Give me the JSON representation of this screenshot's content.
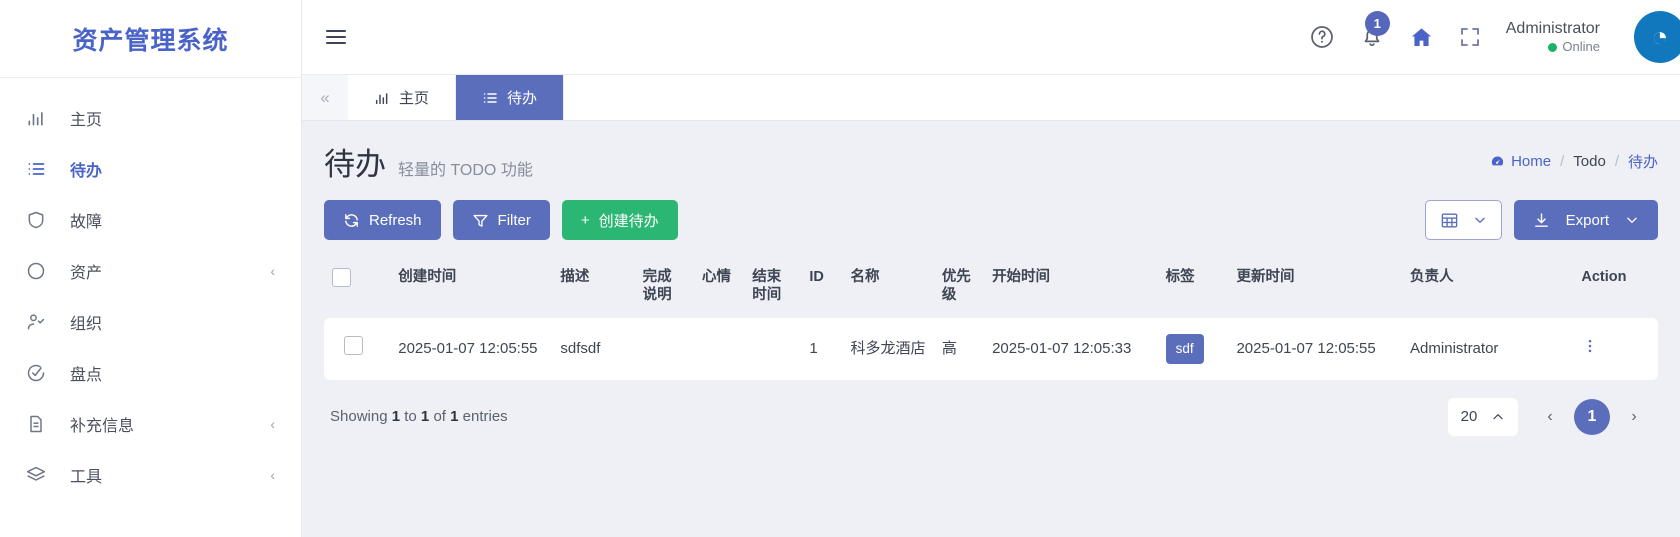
{
  "sidebar": {
    "brand": "资产管理系统",
    "items": [
      {
        "label": "主页",
        "icon": "bar-chart-icon",
        "active": false,
        "caret": ""
      },
      {
        "label": "待办",
        "icon": "list-icon",
        "active": true,
        "caret": ""
      },
      {
        "label": "故障",
        "icon": "shield-icon",
        "active": false,
        "caret": ""
      },
      {
        "label": "资产",
        "icon": "circle-icon",
        "active": false,
        "caret": "‹"
      },
      {
        "label": "组织",
        "icon": "user-check-icon",
        "active": false,
        "caret": ""
      },
      {
        "label": "盘点",
        "icon": "check-circle-icon",
        "active": false,
        "caret": ""
      },
      {
        "label": "补充信息",
        "icon": "file-icon",
        "active": false,
        "caret": "‹"
      },
      {
        "label": "工具",
        "icon": "layers-icon",
        "active": false,
        "caret": "‹"
      }
    ]
  },
  "topbar": {
    "menu_icon": "hamburger-icon",
    "help_icon": "question-circle-icon",
    "notification_icon": "bell-icon",
    "notification_count": "1",
    "home_icon": "home-icon",
    "fullscreen_icon": "fullscreen-icon",
    "user_name": "Administrator",
    "user_status": "Online",
    "avatar_glyph": "◔"
  },
  "tabs": {
    "collapse_icon": "«",
    "items": [
      {
        "label": "主页",
        "icon": "bar-chart-icon",
        "active": false
      },
      {
        "label": "待办",
        "icon": "list-icon",
        "active": true
      }
    ]
  },
  "page": {
    "title": "待办",
    "subtitle": "轻量的 TODO 功能",
    "breadcrumb": {
      "home": "Home",
      "mid": "Todo",
      "current": "待办",
      "sep": "/"
    }
  },
  "toolbar": {
    "refresh_label": "Refresh",
    "filter_label": "Filter",
    "create_label": "创建待办",
    "create_prefix": "+",
    "columns_label": "",
    "export_label": "Export"
  },
  "table": {
    "columns": [
      "创建时间",
      "描述",
      "完成说明",
      "心情",
      "结束时间",
      "ID",
      "名称",
      "优先级",
      "开始时间",
      "标签",
      "更新时间",
      "负责人",
      "Action"
    ],
    "rows": [
      {
        "创建时间": "2025-01-07 12:05:55",
        "描述": "sdfsdf",
        "完成说明": "",
        "心情": "",
        "结束时间": "",
        "ID": "1",
        "名称": "科多龙酒店",
        "优先级": "高",
        "开始时间": "2025-01-07 12:05:33",
        "标签": "sdf",
        "更新时间": "2025-01-07 12:05:55",
        "负责人": "Administrator"
      }
    ]
  },
  "footer": {
    "showing_prefix": "Showing",
    "showing_from": "1",
    "showing_to_word": "to",
    "showing_to": "1",
    "showing_of_word": "of",
    "showing_total": "1",
    "showing_suffix": "entries",
    "page_size": "20",
    "current_page": "1",
    "prev_icon": "‹",
    "next_icon": "›"
  },
  "colors": {
    "accent": "#5a6ebc",
    "brand": "#4a63c8",
    "green": "#2bb673",
    "online": "#18b26b",
    "avatar": "#1278be"
  }
}
